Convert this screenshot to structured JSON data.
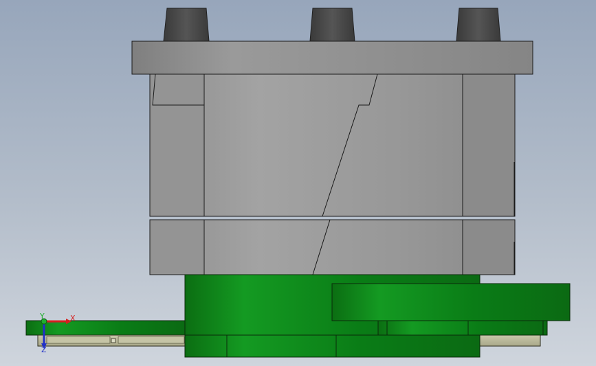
{
  "viewport": {
    "background_top": "#97a6bb",
    "background_bottom": "#cfd5dd"
  },
  "model": {
    "body_color": "#999999",
    "cap_color": "#4a4a4a",
    "plate_color": "#8c8c8c",
    "pcb_color": "#0a7a14",
    "connector_color": "#b9b89a"
  },
  "triad": {
    "x_label": "X",
    "y_label": "Y",
    "z_label": "Z",
    "x_color": "#d42020",
    "y_color": "#20b030",
    "z_color": "#2030c8"
  }
}
